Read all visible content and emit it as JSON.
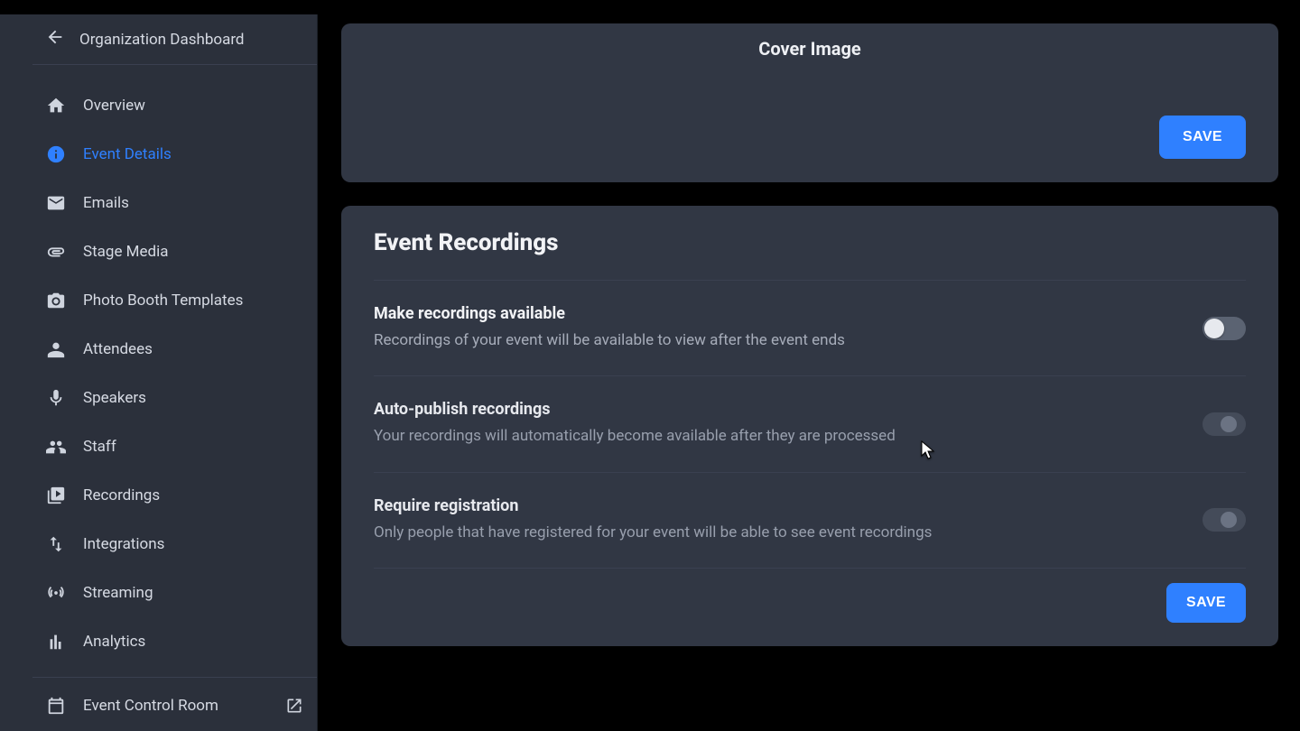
{
  "sidebar": {
    "back_label": "Organization Dashboard",
    "items": [
      {
        "icon": "home-icon",
        "label": "Overview"
      },
      {
        "icon": "info-icon",
        "label": "Event Details",
        "active": true
      },
      {
        "icon": "email-icon",
        "label": "Emails"
      },
      {
        "icon": "attachment-icon",
        "label": "Stage Media"
      },
      {
        "icon": "camera-icon",
        "label": "Photo Booth Templates"
      },
      {
        "icon": "person-icon",
        "label": "Attendees"
      },
      {
        "icon": "mic-icon",
        "label": "Speakers"
      },
      {
        "icon": "people-icon",
        "label": "Staff"
      },
      {
        "icon": "video-library-icon",
        "label": "Recordings"
      },
      {
        "icon": "swap-icon",
        "label": "Integrations"
      },
      {
        "icon": "broadcast-icon",
        "label": "Streaming"
      },
      {
        "icon": "analytics-icon",
        "label": "Analytics"
      }
    ],
    "footer": {
      "icon": "event-icon",
      "label": "Event Control Room",
      "trail_icon": "open-in-new-icon"
    }
  },
  "cover": {
    "title": "Cover Image",
    "save_label": "SAVE"
  },
  "recordings": {
    "title": "Event Recordings",
    "rows": [
      {
        "title": "Make recordings available",
        "desc": "Recordings of your event will be available to view after the event ends",
        "toggle_on": false,
        "disabled": false
      },
      {
        "title": "Auto-publish recordings",
        "desc": "Your recordings will automatically become available after they are processed",
        "toggle_on": false,
        "disabled": true
      },
      {
        "title": "Require registration",
        "desc": "Only people that have registered for your event will be able to see event recordings",
        "toggle_on": false,
        "disabled": true
      }
    ],
    "save_label": "SAVE"
  }
}
